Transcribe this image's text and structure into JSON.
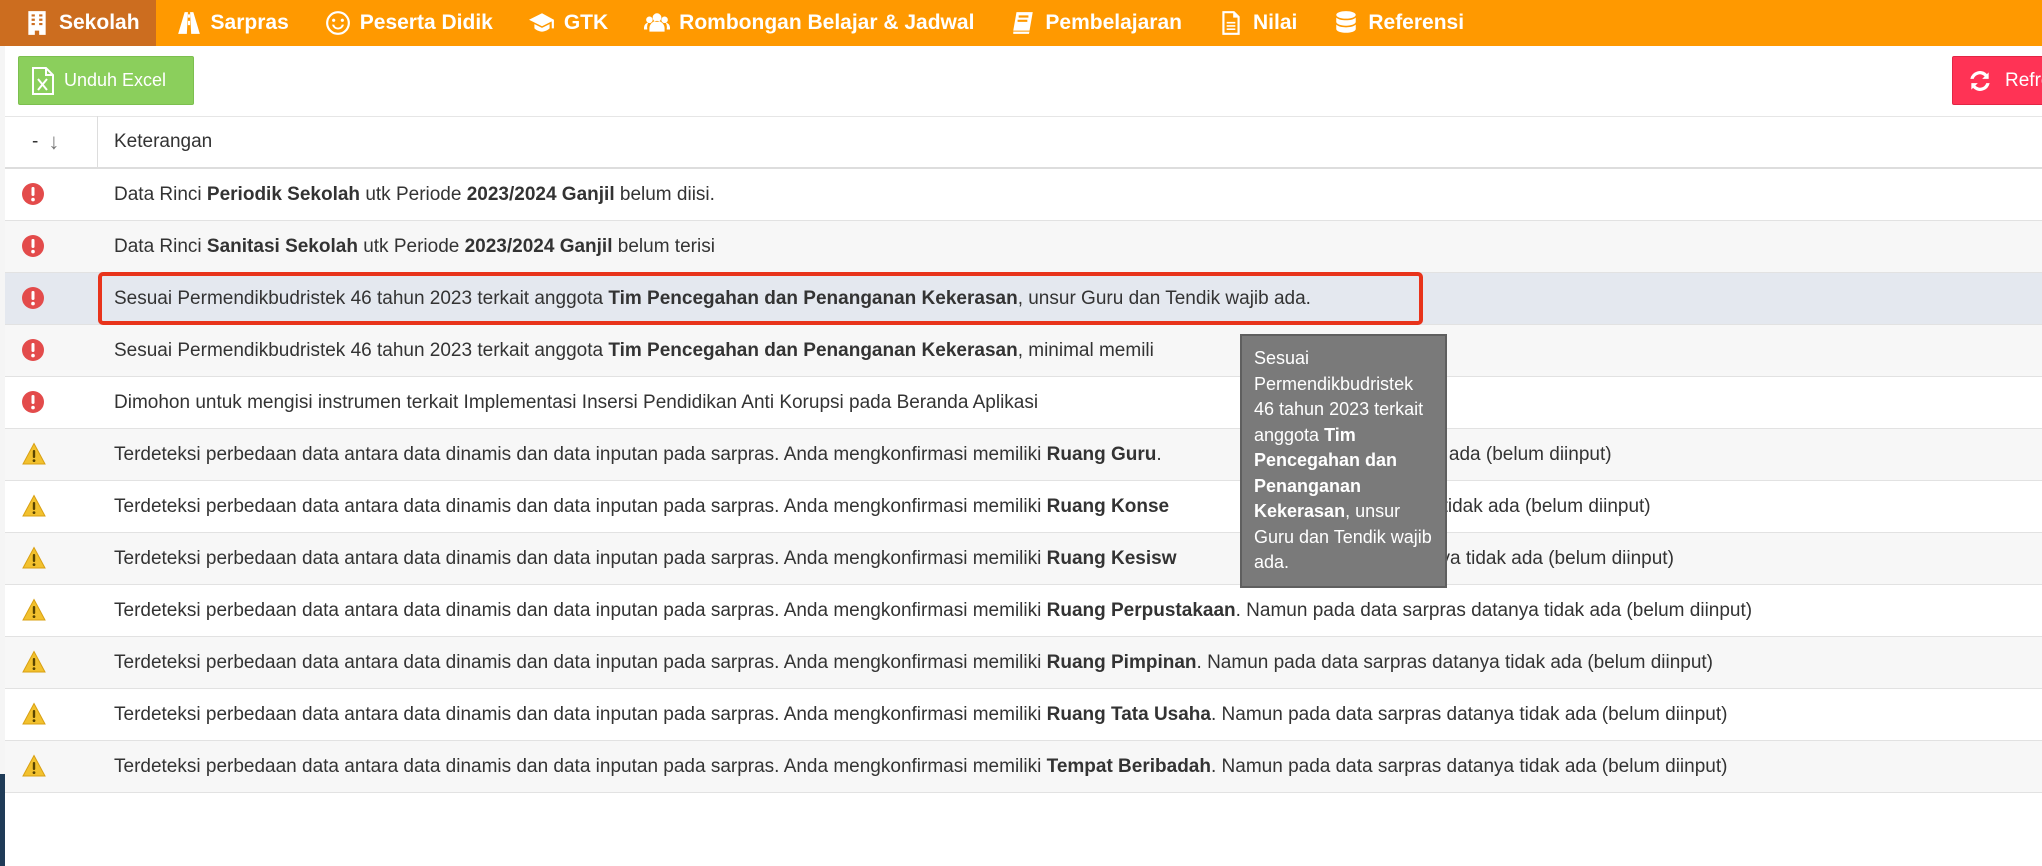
{
  "nav": {
    "items": [
      {
        "label": "Sekolah",
        "icon": "building-icon",
        "active": true
      },
      {
        "label": "Sarpras",
        "icon": "road-icon"
      },
      {
        "label": "Peserta Didik",
        "icon": "smile-icon"
      },
      {
        "label": "GTK",
        "icon": "graduation-cap-icon"
      },
      {
        "label": "Rombongan Belajar & Jadwal",
        "icon": "users-icon"
      },
      {
        "label": "Pembelajaran",
        "icon": "book-icon"
      },
      {
        "label": "Nilai",
        "icon": "file-icon"
      },
      {
        "label": "Referensi",
        "icon": "database-icon"
      }
    ]
  },
  "toolbar": {
    "download_label": "Unduh Excel",
    "refresh_label": "Refresh"
  },
  "table": {
    "sort_label": "-",
    "sort_arrow": "↓",
    "header_keterangan": "Keterangan",
    "rows": [
      {
        "type": "error",
        "parts": [
          [
            "Data Rinci ",
            false
          ],
          [
            "Periodik Sekolah",
            true
          ],
          [
            " utk Periode ",
            false
          ],
          [
            "2023/2024 Ganjil",
            true
          ],
          [
            " belum diisi.",
            false
          ]
        ]
      },
      {
        "type": "error",
        "parts": [
          [
            "Data Rinci ",
            false
          ],
          [
            "Sanitasi Sekolah",
            true
          ],
          [
            " utk Periode ",
            false
          ],
          [
            "2023/2024 Ganjil",
            true
          ],
          [
            " belum terisi",
            false
          ]
        ]
      },
      {
        "type": "error",
        "parts": [
          [
            "Sesuai Permendikbudristek 46 tahun 2023 terkait anggota ",
            false
          ],
          [
            "Tim Pencegahan dan Penanganan Kekerasan",
            true
          ],
          [
            ", unsur Guru dan Tendik wajib ada.",
            false
          ]
        ]
      },
      {
        "type": "error",
        "parts": [
          [
            "Sesuai Permendikbudristek 46 tahun 2023 terkait anggota ",
            false
          ],
          [
            "Tim Pencegahan dan Penanganan Kekerasan",
            true
          ],
          [
            ", minimal memili",
            false
          ]
        ]
      },
      {
        "type": "error",
        "parts": [
          [
            "Dimohon untuk mengisi instrumen terkait Implementasi Insersi Pendidikan Anti Korupsi pada Beranda Aplikasi",
            false
          ]
        ]
      },
      {
        "type": "warning",
        "parts": [
          [
            "Terdeteksi perbedaan data antara data dinamis dan data inputan pada sarpras. Anda mengkonfirmasi memiliki ",
            false
          ],
          [
            "Ruang Guru",
            true
          ],
          [
            ". ",
            false
          ],
          [
            "                         ras datanya tidak ada (belum diinput)",
            false
          ]
        ]
      },
      {
        "type": "warning",
        "parts": [
          [
            "Terdeteksi perbedaan data antara data dinamis dan data inputan pada sarpras. Anda mengkonfirmasi memiliki ",
            false
          ],
          [
            "Ruang Konse",
            true
          ],
          [
            "                         sarpras datanya tidak ada (belum diinput)",
            false
          ]
        ]
      },
      {
        "type": "warning",
        "parts": [
          [
            "Terdeteksi perbedaan data antara data dinamis dan data inputan pada sarpras. Anda mengkonfirmasi memiliki ",
            false
          ],
          [
            "Ruang Kesisw",
            true
          ],
          [
            "                         a sarpras datanya tidak ada (belum diinput)",
            false
          ]
        ]
      },
      {
        "type": "warning",
        "parts": [
          [
            "Terdeteksi perbedaan data antara data dinamis dan data inputan pada sarpras. Anda mengkonfirmasi memiliki ",
            false
          ],
          [
            "Ruang Perpustakaan",
            true
          ],
          [
            ". Namun pada data sarpras datanya tidak ada (belum diinput)",
            false
          ]
        ]
      },
      {
        "type": "warning",
        "parts": [
          [
            "Terdeteksi perbedaan data antara data dinamis dan data inputan pada sarpras. Anda mengkonfirmasi memiliki ",
            false
          ],
          [
            "Ruang Pimpinan",
            true
          ],
          [
            ". Namun pada data sarpras datanya tidak ada (belum diinput)",
            false
          ]
        ]
      },
      {
        "type": "warning",
        "parts": [
          [
            "Terdeteksi perbedaan data antara data dinamis dan data inputan pada sarpras. Anda mengkonfirmasi memiliki ",
            false
          ],
          [
            "Ruang Tata Usaha",
            true
          ],
          [
            ". Namun pada data sarpras datanya tidak ada (belum diinput)",
            false
          ]
        ]
      },
      {
        "type": "warning",
        "parts": [
          [
            "Terdeteksi perbedaan data antara data dinamis dan data inputan pada sarpras. Anda mengkonfirmasi memiliki ",
            false
          ],
          [
            "Tempat Beribadah",
            true
          ],
          [
            ". Namun pada data sarpras datanya tidak ada (belum diinput)",
            false
          ]
        ]
      }
    ]
  },
  "tooltip": {
    "before": "Sesuai Permendikbudristek 46 tahun 2023 terkait anggota ",
    "bold": "Tim Pencegahan dan Penanganan Kekerasan",
    "after": ", unsur Guru dan Tendik wajib ada."
  },
  "colors": {
    "nav_bg": "#ff9900",
    "nav_active": "#cc6d1f",
    "excel_button": "#8bcf5c",
    "refresh_button": "#ff3355",
    "error_icon": "#e34b4b",
    "warning_icon": "#f2c12e",
    "highlight_border": "#e8331b"
  }
}
